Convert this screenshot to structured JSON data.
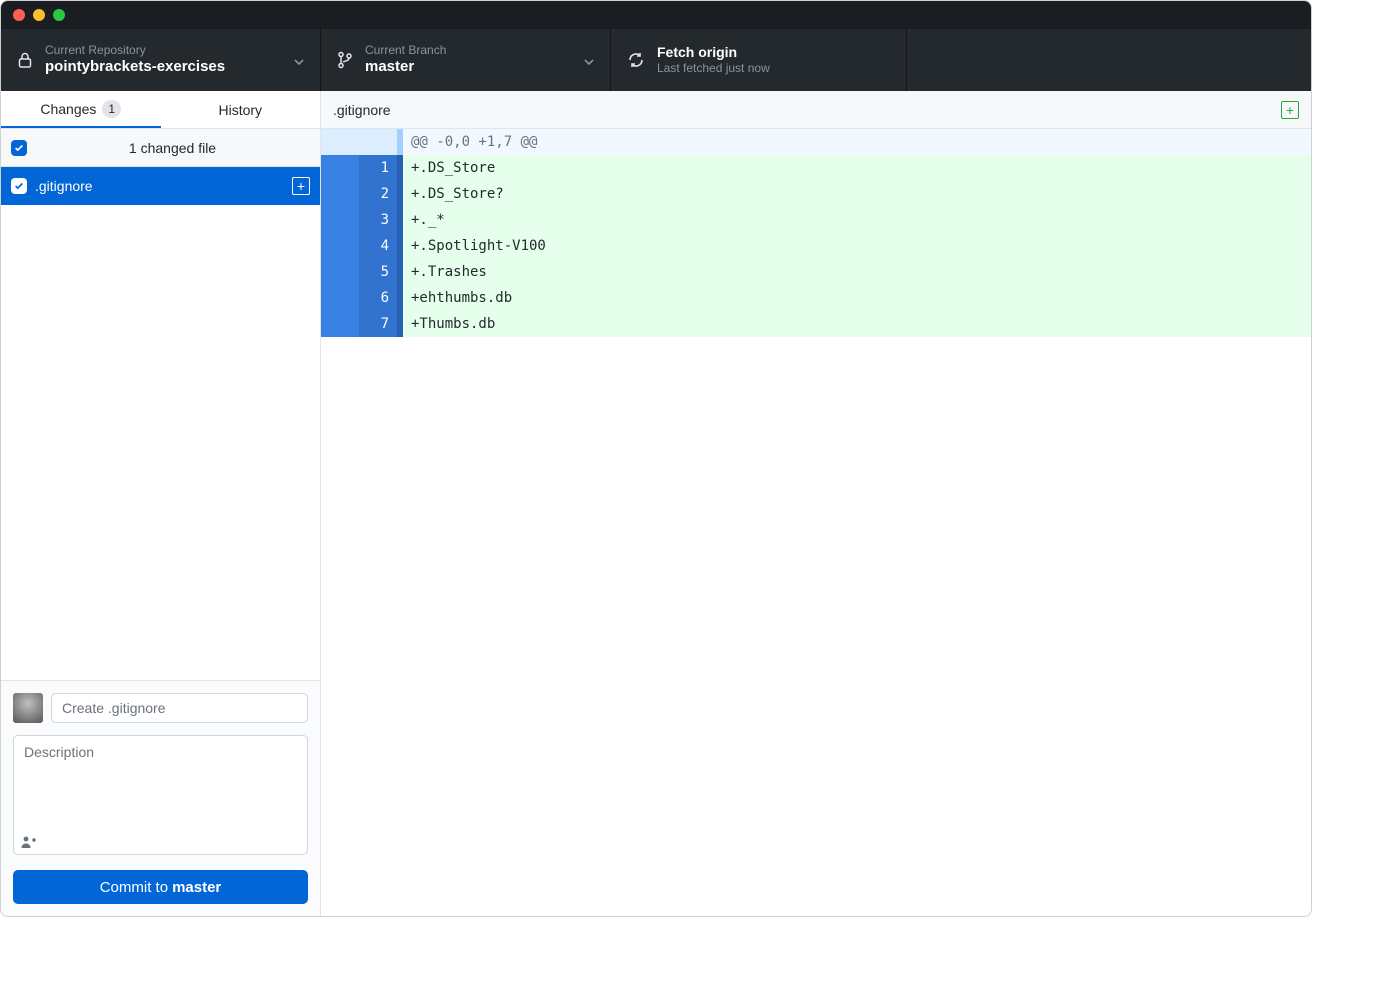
{
  "toolbar": {
    "repo": {
      "label": "Current Repository",
      "value": "pointybrackets-exercises"
    },
    "branch": {
      "label": "Current Branch",
      "value": "master"
    },
    "fetch": {
      "label": "Fetch origin",
      "value": "Last fetched just now"
    }
  },
  "tabs": {
    "changes_label": "Changes",
    "changes_count": "1",
    "history_label": "History"
  },
  "changes_header": {
    "summary": "1 changed file"
  },
  "files": {
    "0": {
      "name": ".gitignore"
    }
  },
  "commit_form": {
    "summary_placeholder": "Create .gitignore",
    "description_placeholder": "Description",
    "button_prefix": "Commit to ",
    "button_branch": "master"
  },
  "diff_file_title": ".gitignore",
  "diff": {
    "hunk": "@@ -0,0 +1,7 @@",
    "lines": {
      "0": {
        "n": "1",
        "text": "+.DS_Store"
      },
      "1": {
        "n": "2",
        "text": "+.DS_Store?"
      },
      "2": {
        "n": "3",
        "text": "+._*"
      },
      "3": {
        "n": "4",
        "text": "+.Spotlight-V100"
      },
      "4": {
        "n": "5",
        "text": "+.Trashes"
      },
      "5": {
        "n": "6",
        "text": "+ehthumbs.db"
      },
      "6": {
        "n": "7",
        "text": "+Thumbs.db"
      }
    }
  }
}
